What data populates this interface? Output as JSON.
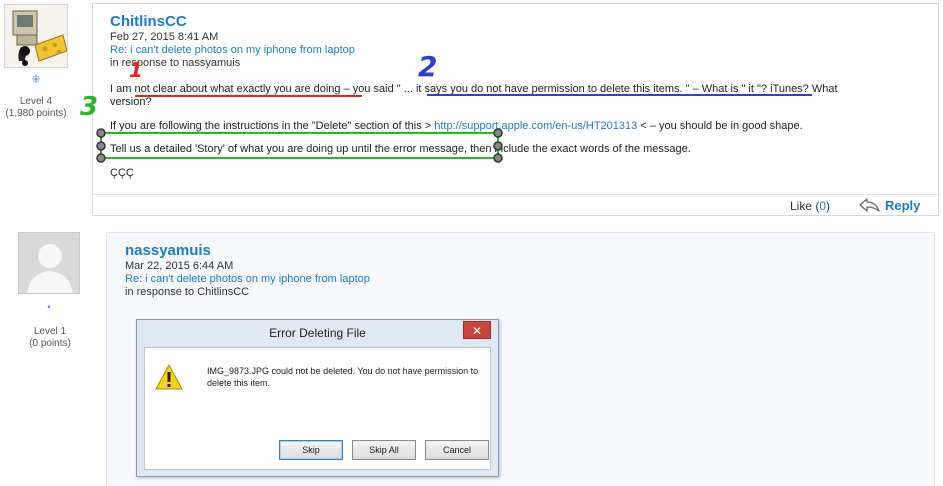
{
  "post1": {
    "author": "ChitlinsCC",
    "date": "Feb 27, 2015 8:41 AM",
    "subject": "Re: i can't delete photos on my iphone from laptop",
    "in_response": "in response to nassyamuis",
    "level": "Level 4",
    "points": "(1,980 points)",
    "line1_a": "I am ",
    "line1_b": "not clear about what exactly you are doing",
    "line1_c": " – you said \" ",
    "line1_d": "... it says you do not have permission to delete this items. \" – What is \" it",
    "line1_e": " \"? iTunes? What",
    "line1_f": "version?",
    "line2_a": "If you are following the instructions in the \"Delete\" section of this > ",
    "line2_link": "http://support.apple.com/en-us/HT201313",
    "line2_b": " < – you should be in good shape.",
    "line3_a": "Tell us a detailed 'Story' of what you are doing up until the error message,",
    "line3_b": " then include the exact words of the message.",
    "signature": "ÇÇÇ",
    "like_label": "Like (",
    "like_count": "0",
    "like_close": ")",
    "reply_label": "Reply"
  },
  "post2": {
    "author": "nassyamuis",
    "date": "Mar 22, 2015 6:44 AM",
    "subject": "Re: i can't delete photos on my iphone from laptop",
    "in_response": "in response to ChitlinsCC",
    "level": "Level 1",
    "points": "(0 points)"
  },
  "annotations": {
    "n1": "1",
    "n2": "2",
    "n3": "3",
    "c1": "#e0261c",
    "c2": "#2f3fcf",
    "c3": "#2cb52c"
  },
  "dialog": {
    "title": "Error Deleting File",
    "message": "IMG_9873.JPG could not be deleted. You do not have permission to delete this item.",
    "buttons": [
      "Skip",
      "Skip All",
      "Cancel"
    ],
    "close": "✕"
  }
}
